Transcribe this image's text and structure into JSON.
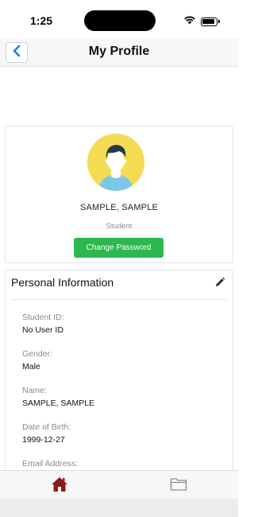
{
  "status_bar": {
    "time": "1:25",
    "icons": [
      "wifi-icon",
      "battery-icon"
    ]
  },
  "nav": {
    "title": "My Profile",
    "back_icon": "chevron-left-icon"
  },
  "profile": {
    "name": "SAMPLE, SAMPLE",
    "role": "Student",
    "change_password_label": "Change Password",
    "avatar_icon": "user-avatar-icon"
  },
  "personal_info": {
    "title": "Personal Information",
    "edit_icon": "pencil-icon",
    "fields": [
      {
        "label": "Student ID:",
        "value": "No User ID"
      },
      {
        "label": "Gender:",
        "value": "Male"
      },
      {
        "label": "Name:",
        "value": "SAMPLE, SAMPLE"
      },
      {
        "label": "Date of Birth:",
        "value": "1999-12-27"
      },
      {
        "label": "Email Address:",
        "value": ""
      }
    ]
  },
  "tab_bar": {
    "tabs": [
      {
        "name": "home",
        "icon": "home-icon",
        "active": true
      },
      {
        "name": "files",
        "icon": "folder-icon",
        "active": false
      }
    ]
  },
  "colors": {
    "accent_blue": "#1e7be6",
    "button_green": "#2db84d",
    "home_active": "#8b1a1a",
    "avatar_bg": "#f4dc52"
  }
}
